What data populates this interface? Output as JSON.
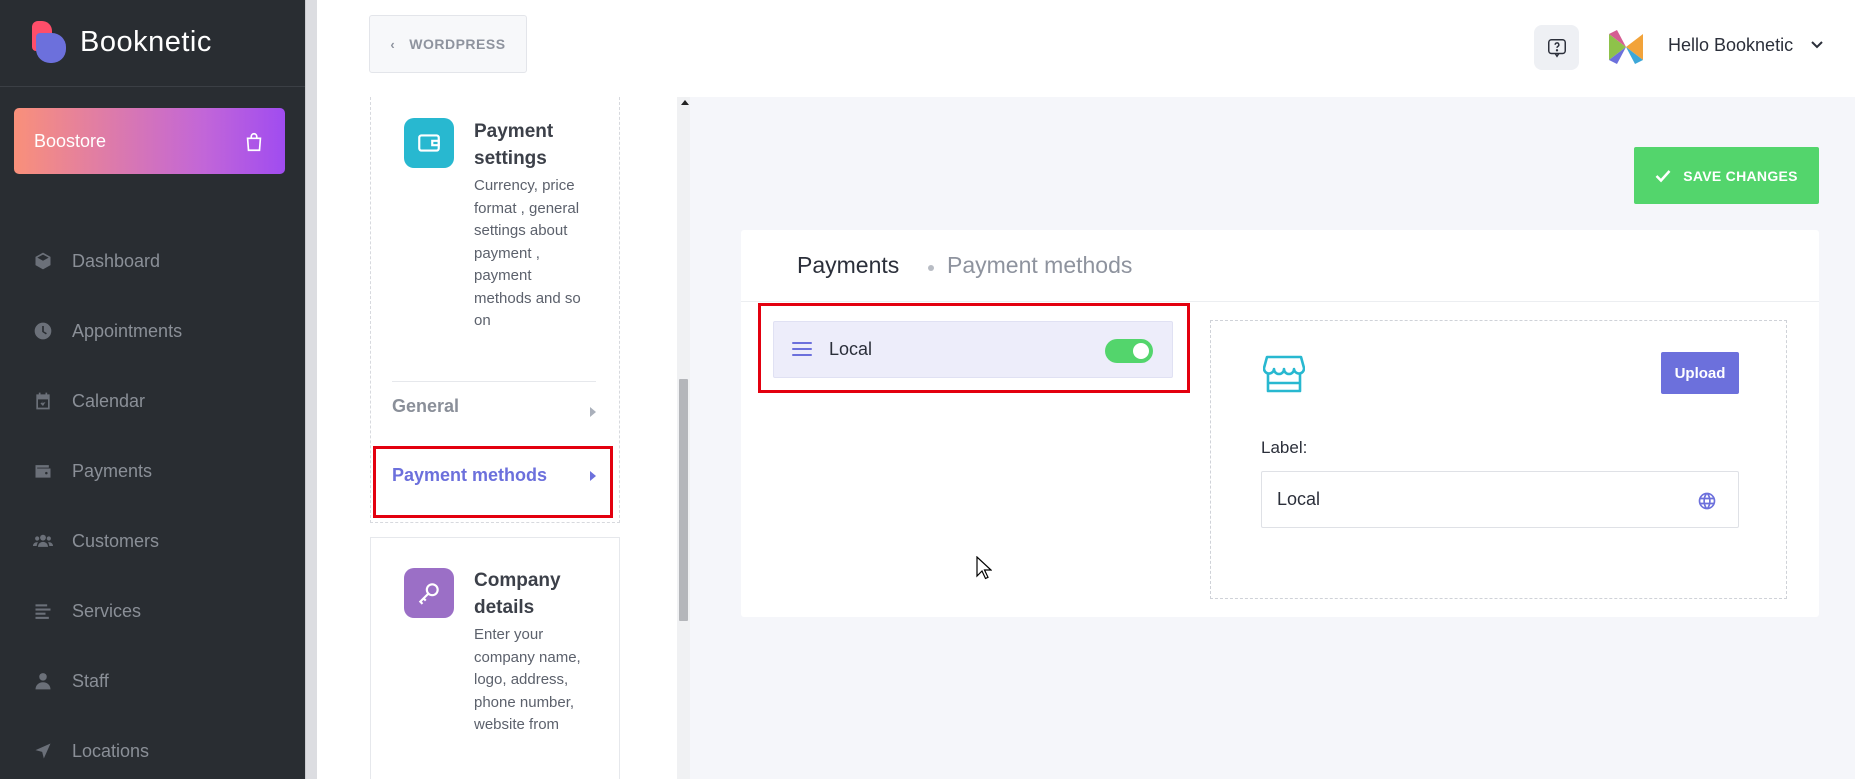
{
  "brand": {
    "name": "Booknetic"
  },
  "boostore": {
    "label": "Boostore",
    "icon": "shopping-bag-icon"
  },
  "nav": {
    "items": [
      {
        "label": "Dashboard",
        "icon": "cube-icon"
      },
      {
        "label": "Appointments",
        "icon": "clock-icon"
      },
      {
        "label": "Calendar",
        "icon": "calendar-icon"
      },
      {
        "label": "Payments",
        "icon": "wallet-icon"
      },
      {
        "label": "Customers",
        "icon": "users-icon"
      },
      {
        "label": "Services",
        "icon": "list-icon"
      },
      {
        "label": "Staff",
        "icon": "user-icon"
      },
      {
        "label": "Locations",
        "icon": "location-arrow-icon"
      }
    ]
  },
  "topbar": {
    "back_label": "WORDPRESS",
    "user_greeting": "Hello Booknetic"
  },
  "settings": {
    "payment": {
      "title": "Payment settings",
      "description": "Currency, price format , general settings about payment , payment methods and so on",
      "subitems": [
        {
          "label": "General",
          "active": false
        },
        {
          "label": "Payment methods",
          "active": true
        }
      ]
    },
    "company": {
      "title": "Company details",
      "description": "Enter your company name, logo, address, phone number, website from"
    }
  },
  "main": {
    "save_label": "SAVE CHANGES",
    "breadcrumb": {
      "title": "Payments",
      "subtitle": "Payment methods"
    },
    "methods": [
      {
        "label": "Local",
        "enabled": true
      }
    ],
    "detail": {
      "upload_label": "Upload",
      "label_caption": "Label:",
      "label_value": "Local"
    }
  },
  "colors": {
    "accent": "#6c70dc",
    "success": "#53d56c",
    "sidebar_bg": "#292d32",
    "highlight": "#e3000f",
    "teal": "#28b8d0",
    "purple": "#9b6fc6"
  }
}
